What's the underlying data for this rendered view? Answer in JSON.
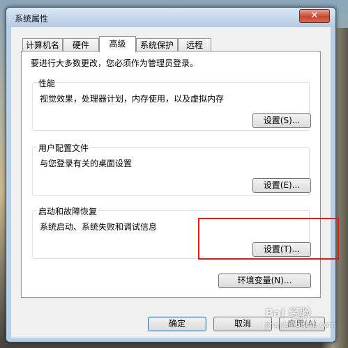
{
  "window": {
    "title": "系统属性",
    "close_label": "✕"
  },
  "tabs": [
    {
      "label": "计算机名"
    },
    {
      "label": "硬件"
    },
    {
      "label": "高级"
    },
    {
      "label": "系统保护"
    },
    {
      "label": "远程"
    }
  ],
  "panel": {
    "note": "要进行大多数更改，您必须作为管理员登录。",
    "performance": {
      "title": "性能",
      "desc": "视觉效果，处理器计划，内存使用，以及虚拟内存",
      "button": "设置(S)..."
    },
    "profiles": {
      "title": "用户配置文件",
      "desc": "与您登录有关的桌面设置",
      "button": "设置(E)..."
    },
    "startup": {
      "title": "启动和故障恢复",
      "desc": "系统启动、系统失败和调试信息",
      "button": "设置(T)..."
    }
  },
  "env_button": "环境变量(N)...",
  "footer": {
    "ok": "确定",
    "cancel": "取消",
    "apply": "应用(A)"
  },
  "watermark": {
    "brand": "Bai 经验",
    "url": "jingyan.baidu.com"
  },
  "colors": {
    "highlight_box": "#e41b1b",
    "title_bar": "#b8cfe6"
  }
}
